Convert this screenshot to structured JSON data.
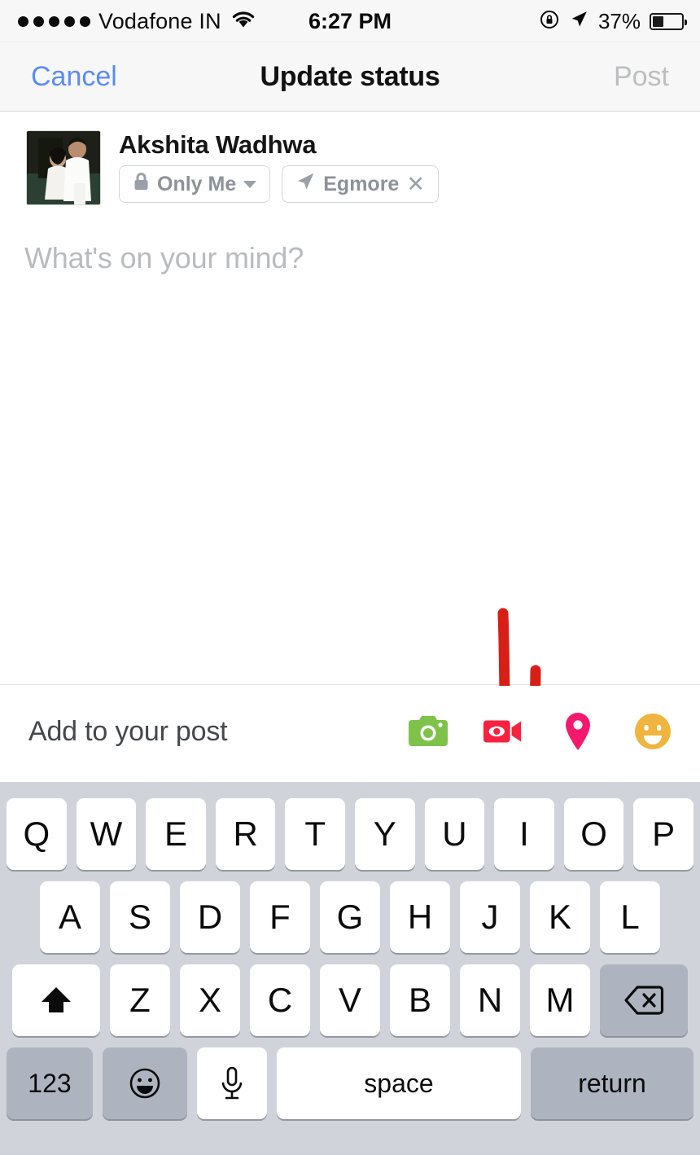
{
  "status_bar": {
    "signal_dots": 5,
    "carrier": "Vodafone IN",
    "wifi_icon": "wifi-icon",
    "time": "6:27 PM",
    "rotation_lock_icon": "rotation-lock-icon",
    "location_icon": "location-arrow-icon",
    "battery_percent_label": "37%",
    "battery_level": 37
  },
  "nav_bar": {
    "cancel_label": "Cancel",
    "title": "Update status",
    "post_label": "Post",
    "post_enabled": false,
    "cancel_color": "#5a8cf5",
    "post_color": "#bcbec0"
  },
  "composer": {
    "user_name": "Akshita Wadhwa",
    "avatar_icon": "profile-photo",
    "audience": {
      "icon": "lock-icon",
      "label": "Only Me",
      "chevron_icon": "chevron-down-icon"
    },
    "location_tag": {
      "icon": "location-arrow-icon",
      "label": "Egmore",
      "remove_icon": "close-icon"
    },
    "placeholder": "What's on your mind?",
    "text_value": ""
  },
  "annotation": {
    "type": "hand-drawn-arrow",
    "direction": "down",
    "color": "#d81f16"
  },
  "add_to_post": {
    "label": "Add to your post",
    "actions": [
      {
        "name": "photo-video-icon",
        "label": "Photo/Video",
        "color": "#7ec24a"
      },
      {
        "name": "live-video-icon",
        "label": "Live Video",
        "color": "#f8213f"
      },
      {
        "name": "check-in-icon",
        "label": "Check In",
        "color": "#f5196e"
      },
      {
        "name": "feeling-activity-icon",
        "label": "Feeling/Activity",
        "color": "#efb53f"
      }
    ]
  },
  "keyboard": {
    "layout": "qwerty-uppercase",
    "row1": [
      "Q",
      "W",
      "E",
      "R",
      "T",
      "Y",
      "U",
      "I",
      "O",
      "P"
    ],
    "row2": [
      "A",
      "S",
      "D",
      "F",
      "G",
      "H",
      "J",
      "K",
      "L"
    ],
    "row3_letters": [
      "Z",
      "X",
      "C",
      "V",
      "B",
      "N",
      "M"
    ],
    "shift_icon": "shift-icon",
    "backspace_icon": "backspace-icon",
    "numbers_label": "123",
    "emoji_icon": "emoji-icon",
    "dictation_icon": "microphone-icon",
    "space_label": "space",
    "return_label": "return",
    "background_color": "#d0d4da"
  }
}
